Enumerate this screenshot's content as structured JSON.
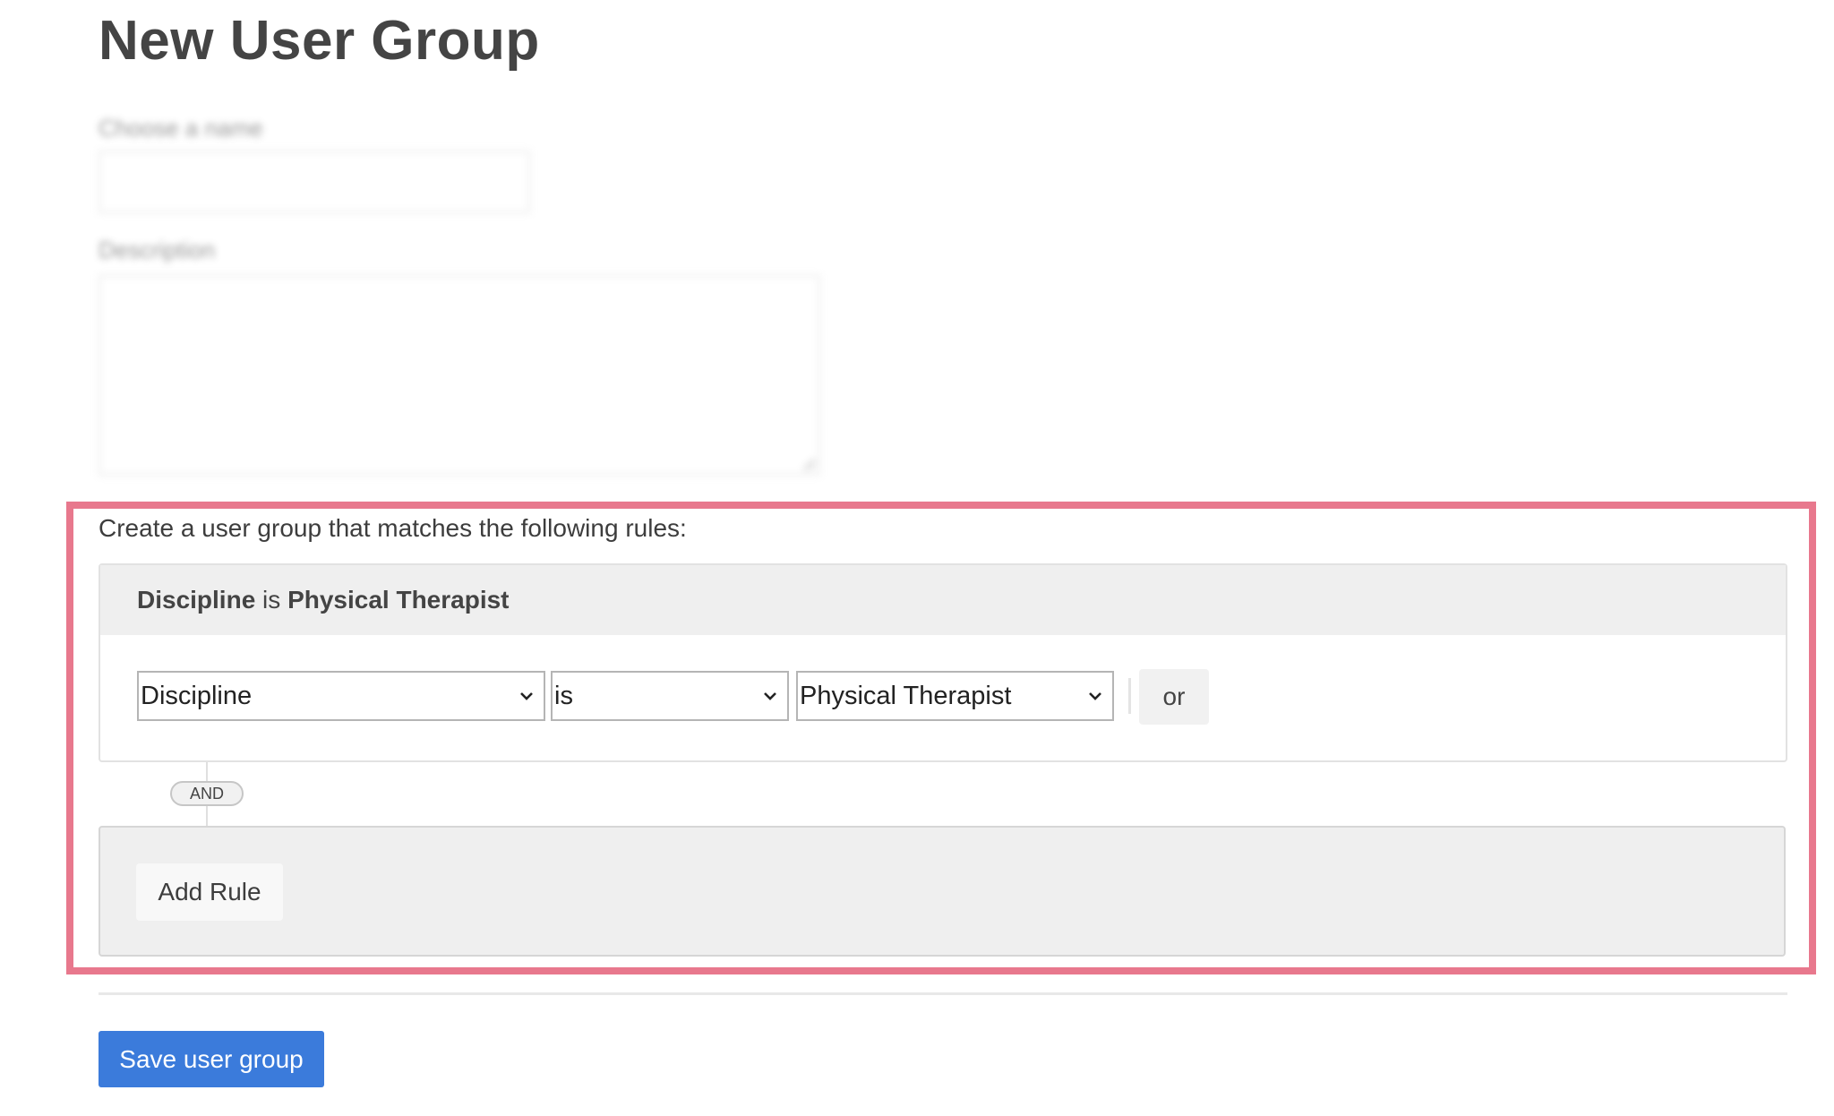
{
  "page": {
    "title": "New User Group"
  },
  "form": {
    "name_label": "Choose a name",
    "name_value": "",
    "description_label": "Description",
    "description_value": ""
  },
  "rules": {
    "intro": "Create a user group that matches the following rules:",
    "groups": [
      {
        "summary": {
          "field": "Discipline",
          "operator": "is",
          "value": "Physical Therapist"
        },
        "field_select": "Discipline",
        "operator_select": "is",
        "value_select": "Physical Therapist",
        "or_label": "or"
      }
    ],
    "connector_label": "AND",
    "add_rule_label": "Add Rule"
  },
  "actions": {
    "save_label": "Save user group"
  },
  "colors": {
    "highlight": "#e8788d",
    "primary": "#3b7bdb"
  },
  "icons": {
    "select_chevron": "chevron-down-icon",
    "textarea_resize": "resize-grip-icon"
  }
}
